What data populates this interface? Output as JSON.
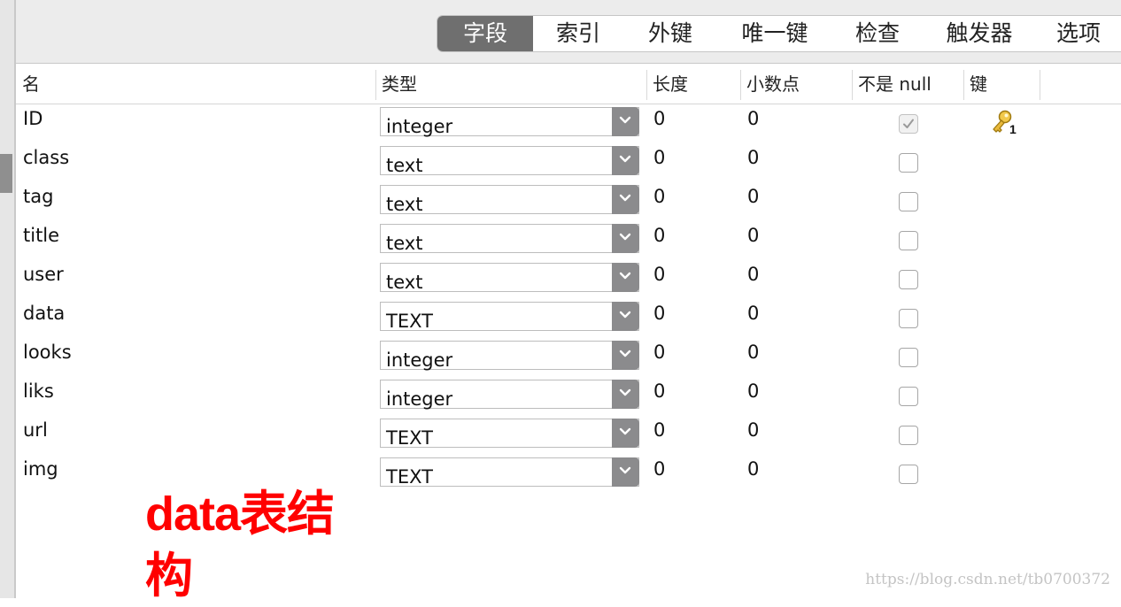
{
  "tabs": [
    "字段",
    "索引",
    "外键",
    "唯一键",
    "检查",
    "触发器",
    "选项"
  ],
  "active_tab": "字段",
  "columns": {
    "name": "名",
    "type": "类型",
    "length": "长度",
    "decimals": "小数点",
    "not_null": "不是 null",
    "key": "键"
  },
  "fields": [
    {
      "name": "ID",
      "type": "integer",
      "length": "0",
      "decimals": "0",
      "not_null": true,
      "key": "1"
    },
    {
      "name": "class",
      "type": "text",
      "length": "0",
      "decimals": "0",
      "not_null": false
    },
    {
      "name": "tag",
      "type": "text",
      "length": "0",
      "decimals": "0",
      "not_null": false
    },
    {
      "name": "title",
      "type": "text",
      "length": "0",
      "decimals": "0",
      "not_null": false
    },
    {
      "name": "user",
      "type": "text",
      "length": "0",
      "decimals": "0",
      "not_null": false
    },
    {
      "name": "data",
      "type": "TEXT",
      "length": "0",
      "decimals": "0",
      "not_null": false
    },
    {
      "name": "looks",
      "type": "integer",
      "length": "0",
      "decimals": "0",
      "not_null": false
    },
    {
      "name": "liks",
      "type": "integer",
      "length": "0",
      "decimals": "0",
      "not_null": false
    },
    {
      "name": "url",
      "type": "TEXT",
      "length": "0",
      "decimals": "0",
      "not_null": false
    },
    {
      "name": "img",
      "type": "TEXT",
      "length": "0",
      "decimals": "0",
      "not_null": false
    }
  ],
  "annotation": "data表结构",
  "watermark": "https://blog.csdn.net/tb0700372",
  "colors": {
    "annotation": "#ff0000",
    "active_tab_bg": "#6f6f6f",
    "key_icon": "#e9b93b"
  },
  "icons": {
    "key": "key-icon",
    "dropdown": "chevron-down-icon",
    "check": "check-icon"
  }
}
